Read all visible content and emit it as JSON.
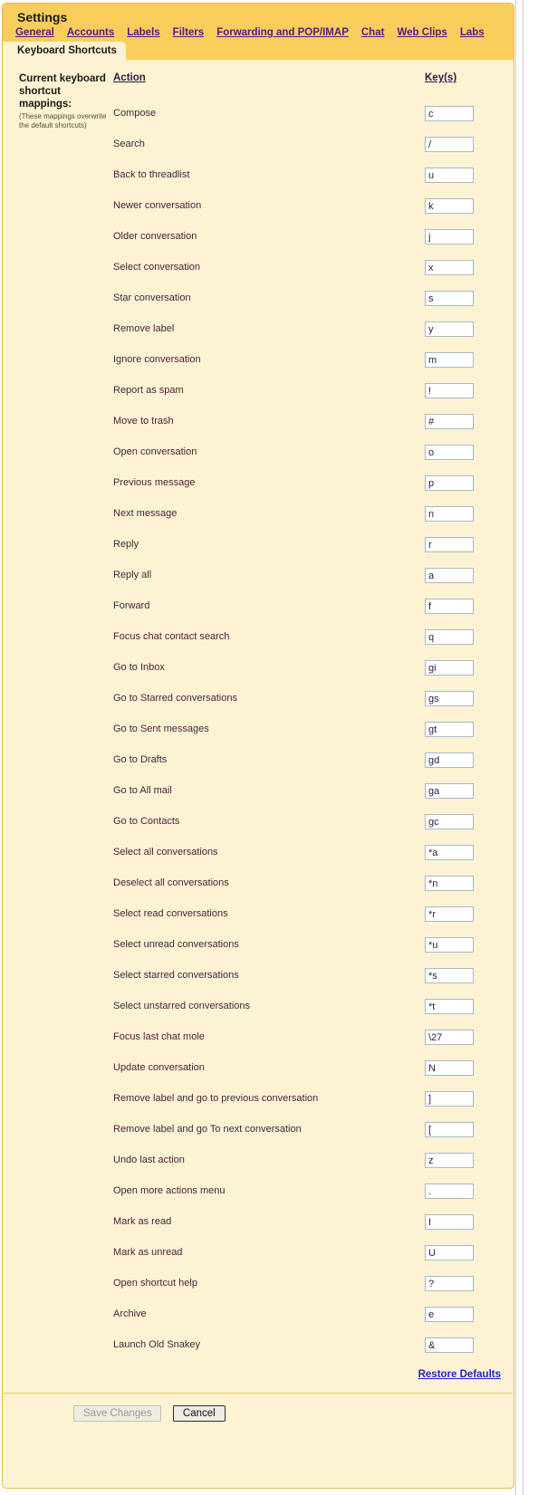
{
  "window": {
    "title": "Settings"
  },
  "tabs": [
    {
      "label": "General",
      "active": false
    },
    {
      "label": "Accounts",
      "active": false
    },
    {
      "label": "Labels",
      "active": false
    },
    {
      "label": "Filters",
      "active": false
    },
    {
      "label": "Forwarding and POP/IMAP",
      "active": false
    },
    {
      "label": "Chat",
      "active": false
    },
    {
      "label": "Web Clips",
      "active": false
    },
    {
      "label": "Labs",
      "active": false
    }
  ],
  "active_tab": {
    "label": "Keyboard Shortcuts"
  },
  "sidebar": {
    "heading": "Current keyboard shortcut mappings:",
    "note": "(These mappings overwrite the default shortcuts)"
  },
  "table": {
    "headers": {
      "action": "Action",
      "keys": "Key(s)"
    },
    "rows": [
      {
        "action": "Compose",
        "key": "c"
      },
      {
        "action": "Search",
        "key": "/"
      },
      {
        "action": "Back to threadlist",
        "key": "u"
      },
      {
        "action": "Newer conversation",
        "key": "k"
      },
      {
        "action": "Older conversation",
        "key": "j"
      },
      {
        "action": "Select conversation",
        "key": "x"
      },
      {
        "action": "Star conversation",
        "key": "s"
      },
      {
        "action": "Remove label",
        "key": "y"
      },
      {
        "action": "Ignore conversation",
        "key": "m"
      },
      {
        "action": "Report as spam",
        "key": "!"
      },
      {
        "action": "Move to trash",
        "key": "#"
      },
      {
        "action": "Open conversation",
        "key": "o"
      },
      {
        "action": "Previous message",
        "key": "p"
      },
      {
        "action": "Next message",
        "key": "n"
      },
      {
        "action": "Reply",
        "key": "r"
      },
      {
        "action": "Reply all",
        "key": "a"
      },
      {
        "action": "Forward",
        "key": "f"
      },
      {
        "action": "Focus chat contact search",
        "key": "q"
      },
      {
        "action": "Go to Inbox",
        "key": "gi"
      },
      {
        "action": "Go to Starred conversations",
        "key": "gs"
      },
      {
        "action": "Go to Sent messages",
        "key": "gt"
      },
      {
        "action": "Go to Drafts",
        "key": "gd"
      },
      {
        "action": "Go to All mail",
        "key": "ga"
      },
      {
        "action": "Go to Contacts",
        "key": "gc"
      },
      {
        "action": "Select all conversations",
        "key": "*a"
      },
      {
        "action": "Deselect all conversations",
        "key": "*n"
      },
      {
        "action": "Select read conversations",
        "key": "*r"
      },
      {
        "action": "Select unread conversations",
        "key": "*u"
      },
      {
        "action": "Select starred conversations",
        "key": "*s"
      },
      {
        "action": "Select unstarred conversations",
        "key": "*t"
      },
      {
        "action": "Focus last chat mole",
        "key": "\\27"
      },
      {
        "action": "Update conversation",
        "key": "N"
      },
      {
        "action": "Remove label and go to previous conversation",
        "key": "]"
      },
      {
        "action": "Remove label and go To next conversation",
        "key": "["
      },
      {
        "action": "Undo last action",
        "key": "z"
      },
      {
        "action": "Open more actions menu",
        "key": "."
      },
      {
        "action": "Mark as read",
        "key": "I"
      },
      {
        "action": "Mark as unread",
        "key": "U"
      },
      {
        "action": "Open shortcut help",
        "key": "?"
      },
      {
        "action": "Archive",
        "key": "e"
      },
      {
        "action": "Launch Old Snakey",
        "key": "&"
      }
    ]
  },
  "links": {
    "restore_defaults": "Restore Defaults"
  },
  "footer": {
    "save_label": "Save Changes",
    "cancel_label": "Cancel"
  },
  "colors": {
    "header_gold": "#f8cd5c",
    "body_cream": "#fdf3d2",
    "panel_border": "#e8b84b",
    "tab_link": "#551a8b",
    "action_text": "#4a2040",
    "restore_link": "#2222cc",
    "input_border": "#a8b8c8"
  }
}
